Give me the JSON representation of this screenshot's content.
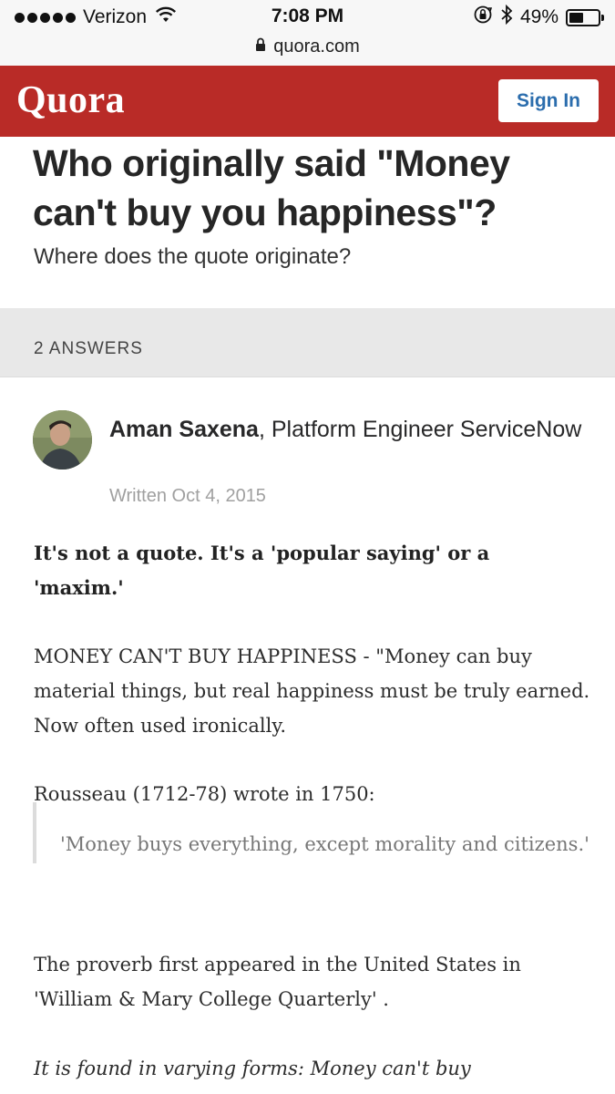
{
  "status_bar": {
    "carrier": "Verizon",
    "time": "7:08 PM",
    "battery": "49%",
    "battery_level": 0.49,
    "signal_icon": "signal-dots-icon",
    "wifi_icon": "wifi-icon",
    "lock_rotation_icon": "orientation-lock-icon",
    "bluetooth_icon": "bluetooth-icon"
  },
  "url_bar": {
    "domain": "quora.com",
    "icon": "lock-icon"
  },
  "header": {
    "logo": "Quora",
    "sign_in_label": "Sign In",
    "brand_color": "#b92b27",
    "link_color": "#2b6dad"
  },
  "question": {
    "title": "Who originally said \"Money can't buy you happiness\"?",
    "detail": "Where does the quote originate?"
  },
  "answers_count_label": "2 ANSWERS",
  "answer": {
    "author_name": "Aman Saxena",
    "author_credential": ", Platform Engineer ServiceNow",
    "written": "Written Oct 4, 2015",
    "lead": "It's not a quote. It's a 'popular saying' or a 'maxim.'",
    "paragraph_1": "MONEY CAN'T BUY HAPPINESS - \"Money can buy material things, but  real happiness must be truly earned. Now often used ironically.",
    "paragraph_2": "Rousseau (1712-78) wrote in 1750:",
    "blockquote": "'Money buys everything, except  morality and citizens.'",
    "paragraph_3": "The proverb first appeared in the United  States in 'William & Mary College Quarterly' .",
    "paragraph_4": "It is found  in varying forms: Money can't buy"
  }
}
